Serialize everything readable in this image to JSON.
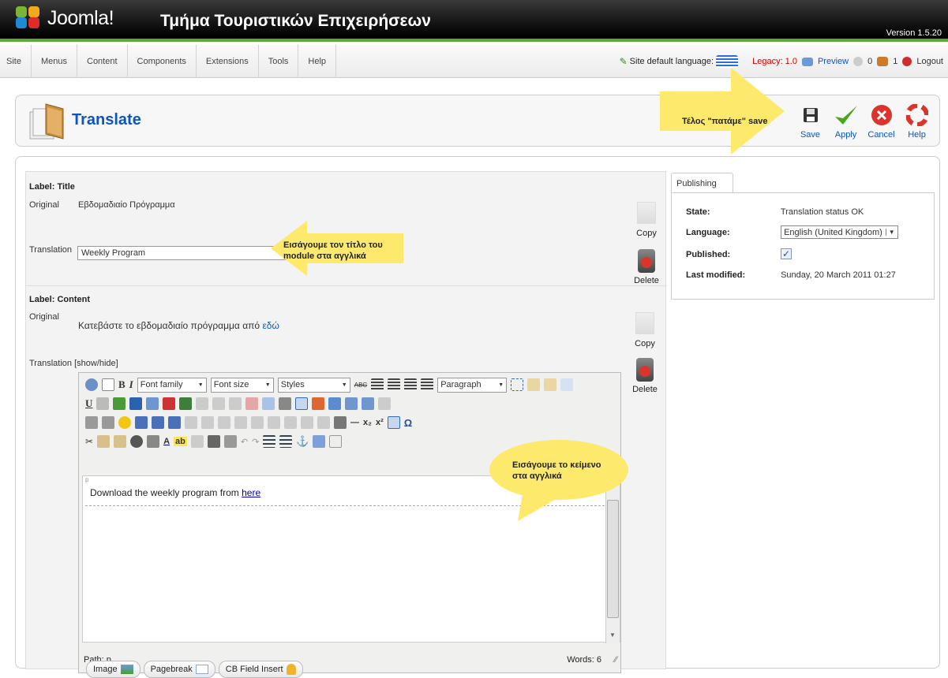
{
  "header": {
    "logo_word": "Joomla!",
    "site_title": "Τμήμα Τουριστικών Επιχειρήσεων",
    "version": "Version 1.5.20"
  },
  "menu": [
    "Site",
    "Menus",
    "Content",
    "Components",
    "Extensions",
    "Tools",
    "Help"
  ],
  "status": {
    "site_language_label": "Site default language:",
    "legacy": "Legacy: 1.0",
    "preview": "Preview",
    "messages_count": "0",
    "users_count": "1",
    "logout": "Logout"
  },
  "toolbar": {
    "title": "Translate",
    "save": "Save",
    "apply": "Apply",
    "cancel": "Cancel",
    "help": "Help"
  },
  "callouts": {
    "save_note": "Τέλος \"πατάμε\" save",
    "title_note_line1": "Εισάγουμε τον τίτλο του",
    "title_note_line2": "module στα αγγλικά",
    "content_note_line1": "Εισάγουμε το κείμενο",
    "content_note_line2": "στα αγγλικά"
  },
  "title_section": {
    "label": "Label: Title",
    "original_label": "Original",
    "original_value": "Εβδομαδιαίο Πρόγραμμα",
    "translation_label": "Translation",
    "translation_value": "Weekly Program",
    "copy": "Copy",
    "delete": "Delete"
  },
  "content_section": {
    "label": "Label: Content",
    "original_label": "Original",
    "original_text": "Κατεβάστε το εβδομαδιαίο πρόγραμμα από",
    "original_link": "εδώ",
    "translation_label": "Translation",
    "show_hide": "[show/hide]",
    "copy": "Copy",
    "delete": "Delete"
  },
  "editor": {
    "font_family": "Font family",
    "font_size": "Font size",
    "styles": "Styles",
    "format": "Paragraph",
    "p_marker": "p",
    "body_text": "Download the weekly program from",
    "body_link": "here",
    "path": "Path: p",
    "words": "Words: 6"
  },
  "bottom_buttons": [
    "Image",
    "Pagebreak",
    "CB Field Insert"
  ],
  "publishing": {
    "tab": "Publishing",
    "state_label": "State:",
    "state_value": "Translation status OK",
    "language_label": "Language:",
    "language_value": "English (United Kingdom)",
    "published_label": "Published:",
    "published_checked": true,
    "modified_label": "Last modified:",
    "modified_value": "Sunday, 20 March 2011 01:27"
  }
}
